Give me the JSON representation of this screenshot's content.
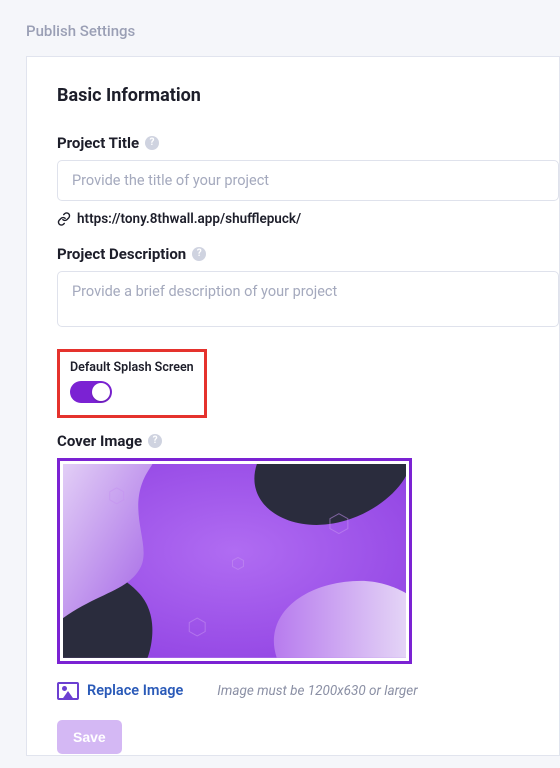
{
  "page": {
    "title": "Publish Settings"
  },
  "basic": {
    "heading": "Basic Information",
    "project_title": {
      "label": "Project Title",
      "placeholder": "Provide the title of your project",
      "value": ""
    },
    "url": "https://tony.8thwall.app/shufflepuck/",
    "description": {
      "label": "Project Description",
      "placeholder": "Provide a brief description of your project",
      "value": ""
    },
    "splash": {
      "label": "Default Splash Screen",
      "enabled": true,
      "highlight_color": "#e5322d"
    },
    "cover": {
      "label": "Cover Image",
      "replace_label": "Replace Image",
      "hint": "Image must be 1200x630 or larger",
      "border_color": "#7b22d3"
    },
    "save_label": "Save"
  },
  "colors": {
    "accent_purple": "#7b22d3",
    "link_blue": "#2a5ab8",
    "error_red": "#e5322d"
  }
}
